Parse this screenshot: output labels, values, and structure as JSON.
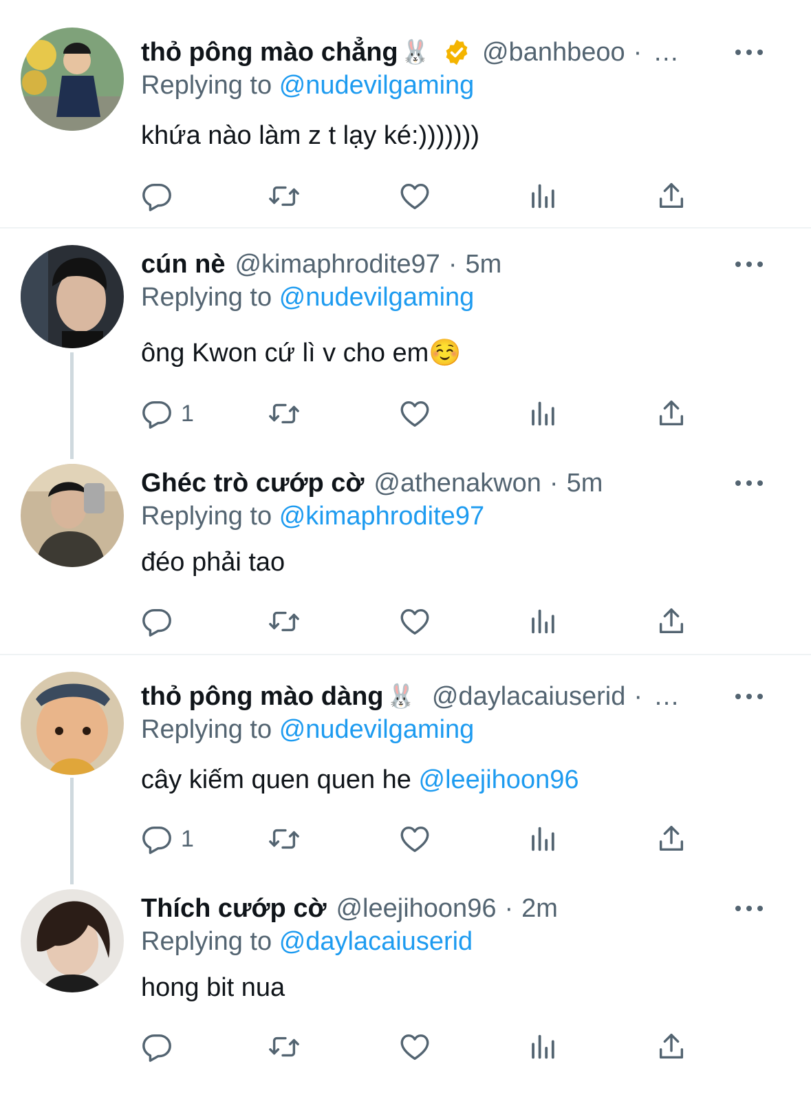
{
  "tweets": [
    {
      "name": "thỏ pông mào chẳng",
      "name_emoji": "🐰",
      "verified": true,
      "handle": "@banhbeoo",
      "time_trunc": "…",
      "replying_label": "Replying to",
      "replying_to": "@nudevilgaming",
      "text": "khứa nào làm z t lạy ké:)))))))",
      "reply_count": ""
    },
    {
      "name": "cún nè",
      "handle": "@kimaphrodite97",
      "time": "5m",
      "replying_label": "Replying to",
      "replying_to": "@nudevilgaming",
      "text": "ông Kwon cứ lì v cho em☺️",
      "reply_count": "1"
    },
    {
      "name": "Ghéc trò cướp cờ",
      "handle": "@athenakwon",
      "time": "5m",
      "replying_label": "Replying to",
      "replying_to": "@kimaphrodite97",
      "text": "đéo phải tao",
      "reply_count": ""
    },
    {
      "name": "thỏ pông mào dàng",
      "name_emoji": "🐰",
      "handle": "@daylacaiuserid",
      "time_trunc": "…",
      "replying_label": "Replying to",
      "replying_to": "@nudevilgaming",
      "text": "cây kiếm quen quen he ",
      "text_mention": "@leejihoon96",
      "reply_count": "1"
    },
    {
      "name": "Thích cướp cờ",
      "handle": "@leejihoon96",
      "time": "2m",
      "replying_label": "Replying to",
      "replying_to": "@daylacaiuserid",
      "text": "hong bit nua",
      "reply_count": ""
    }
  ],
  "dot_separator": "·",
  "colors": {
    "link": "#1d9bf0",
    "muted": "#536471",
    "text": "#0f1419",
    "verified": "#f4b400"
  },
  "icons": [
    "reply-icon",
    "retweet-icon",
    "like-icon",
    "views-icon",
    "share-icon",
    "more-icon",
    "verified-badge-icon"
  ]
}
